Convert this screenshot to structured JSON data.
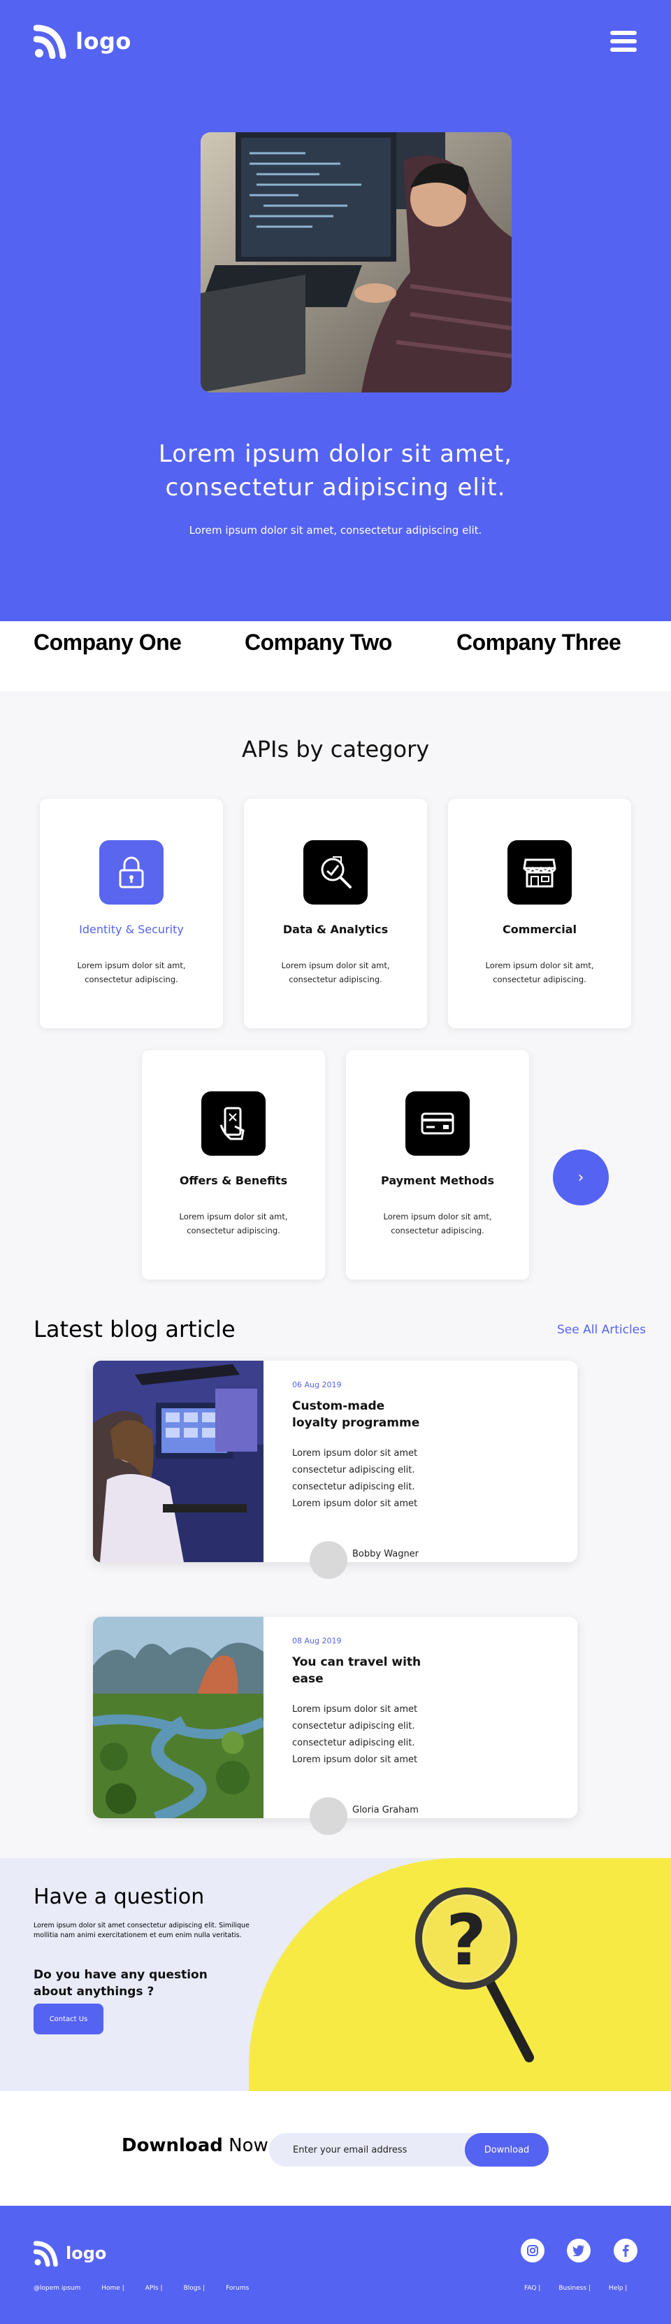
{
  "header": {
    "logo_text": "logo",
    "menu_icon": "hamburger-menu-icon"
  },
  "hero": {
    "title": "Lorem ipsum dolor sit amet, consectetur adipiscing elit.",
    "subtitle": "Lorem ipsum dolor sit amet, consectetur adipiscing elit.",
    "image": "developer-at-computer-photo"
  },
  "companies": [
    "Company One",
    "Company Two",
    "Company Three"
  ],
  "apis": {
    "title": "APIs by category",
    "items": [
      {
        "name": "Identity & Security",
        "icon": "padlock-icon",
        "desc": "Lorem ipsum dolor sit amt, consectetur adipiscing.",
        "active": true
      },
      {
        "name": "Data & Analytics",
        "icon": "analytics-search-icon",
        "desc": "Lorem ipsum dolor sit amt, consectetur adipiscing.",
        "active": false
      },
      {
        "name": "Commercial",
        "icon": "storefront-icon",
        "desc": "Lorem ipsum dolor sit amt, consectetur adipiscing.",
        "active": false
      },
      {
        "name": "Offers & Benefits",
        "icon": "mobile-offer-icon",
        "desc": "Lorem ipsum dolor sit amt, consectetur adipiscing.",
        "active": false
      },
      {
        "name": "Payment Methods",
        "icon": "credit-card-icon",
        "desc": "Lorem ipsum dolor sit amt, consectetur adipiscing.",
        "active": false
      }
    ],
    "next_glyph": "›"
  },
  "blog": {
    "title": "Latest blog article",
    "see_all": "See All Articles",
    "posts": [
      {
        "date": "06 Aug 2019",
        "title": "Custom-made loyalty programme",
        "body": "Lorem ipsum dolor sit amet consectetur adipiscing elit. consectetur adipiscing elit. Lorem ipsum dolor sit amet",
        "author": "Bobby Wagner",
        "image": "woman-at-monitors-photo"
      },
      {
        "date": "08 Aug 2019",
        "title": "You can travel with ease",
        "body": "Lorem ipsum dolor sit amet consectetur adipiscing elit. consectetur adipiscing elit. Lorem ipsum dolor sit amet",
        "author": "Gloria Graham",
        "image": "river-landscape-photo"
      }
    ]
  },
  "question": {
    "title": "Have a question",
    "text": "Lorem ipsum dolor sit amet consectetur adipiscing elit. Similique mollitia nam animi exercitationem et eum enim nulla veritatis.",
    "sub": "Do you have any question about anythings ?",
    "button": "Contact Us",
    "image": "magnifying-glass-question-mark"
  },
  "download": {
    "label_bold": "Download",
    "label_rest": " Now",
    "placeholder": "Enter your email address",
    "button": "Download"
  },
  "footer": {
    "logo_text": "logo",
    "links": [
      "@lopem ipsum",
      "Home |",
      "APIs |",
      "Blogs |",
      "Forums"
    ],
    "right_links": [
      "FAQ |",
      "Business |",
      "Help |"
    ],
    "social": [
      "instagram-icon",
      "twitter-icon",
      "facebook-icon"
    ]
  },
  "colors": {
    "primary": "#5563f2",
    "yellow": "#f7ea45",
    "light": "#e9ebf9"
  }
}
